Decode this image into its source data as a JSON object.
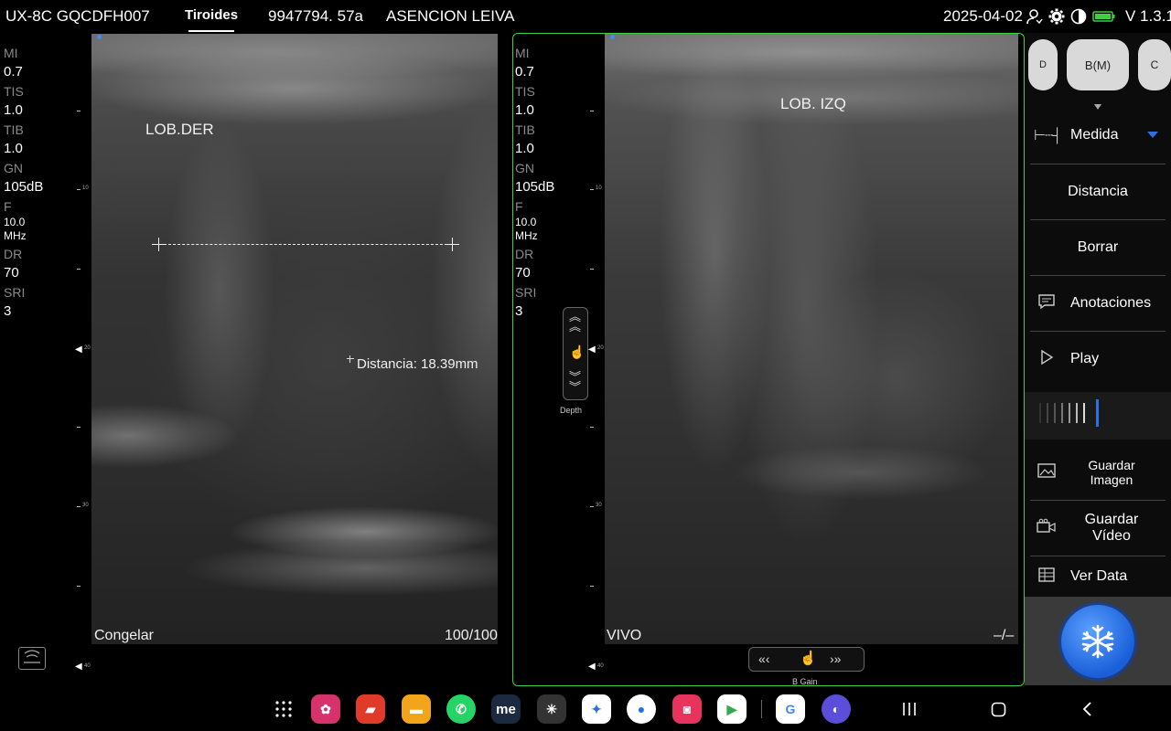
{
  "topbar": {
    "device": "UX-8C GQCDFH007",
    "exam_tab": "Tiroides",
    "patient_id": "9947794. 57a",
    "patient_name": "ASENCION LEIVA",
    "date": "2025-04-02",
    "version": "V 1.3.1"
  },
  "params": [
    {
      "label": "MI",
      "value": "0.7"
    },
    {
      "label": "TIS",
      "value": "1.0"
    },
    {
      "label": "TIB",
      "value": "1.0"
    },
    {
      "label": "GN",
      "value": "105dB"
    },
    {
      "label": "F",
      "value": "10.0\nMHz"
    },
    {
      "label": "DR",
      "value": "70"
    },
    {
      "label": "SRI",
      "value": "3"
    }
  ],
  "left_pane": {
    "annotation": "LOB.DER",
    "measurement": "Distancia: 18.39mm",
    "state": "Congelar",
    "frame": "100/100"
  },
  "right_pane": {
    "annotation": "LOB. IZQ",
    "state": "VIVO",
    "frame": "–/–"
  },
  "scale_labels": [
    "10",
    "20",
    "30",
    "40"
  ],
  "controls": {
    "depth": "Depth",
    "gain": "B Gain"
  },
  "side_menu": {
    "modes": [
      "D",
      "B(M)",
      "C"
    ],
    "measure_label": "Medida",
    "items": [
      {
        "label": "Distancia",
        "icon": ""
      },
      {
        "label": "Borrar",
        "icon": ""
      },
      {
        "label": "Anotaciones",
        "icon": "comment-icon"
      },
      {
        "label": "Play",
        "icon": "play-icon"
      },
      {
        "label": "Guardar Imagen",
        "icon": "image-icon"
      },
      {
        "label": "Guardar Vídeo",
        "icon": "video-icon"
      },
      {
        "label": "Ver Data",
        "icon": "table-icon"
      }
    ]
  },
  "colors": {
    "active_frame": "#3fd03f",
    "accent": "#2f6fe0",
    "battery": "#3fd03f"
  }
}
